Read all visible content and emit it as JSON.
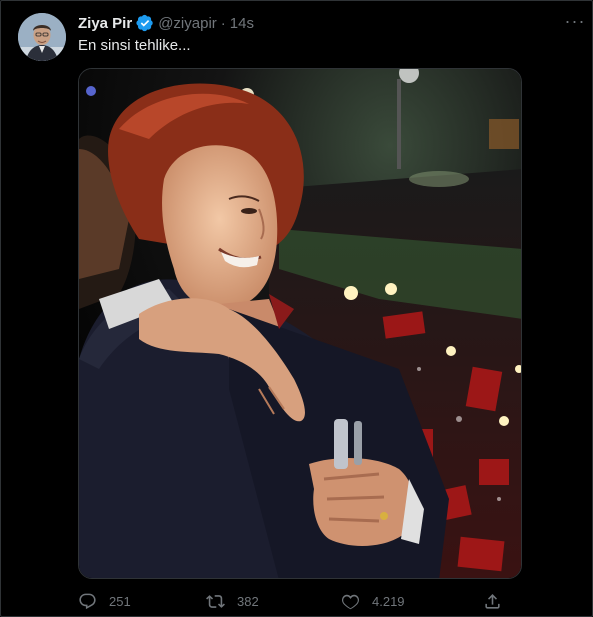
{
  "tweet": {
    "author_name": "Ziya Pir",
    "handle": "@ziyapir",
    "separator": "·",
    "time": "14s",
    "text": "En sinsi tehlike...",
    "verified": true
  },
  "actions": {
    "replies": "251",
    "retweets": "382",
    "likes": "4.219"
  },
  "colors": {
    "background": "#000000",
    "text": "#e7e9ea",
    "muted": "#71767b",
    "verified": "#1d9bf0",
    "border": "#2f3336"
  },
  "icons": [
    "verified-badge-icon",
    "more-icon",
    "reply-icon",
    "retweet-icon",
    "like-icon",
    "share-icon"
  ]
}
